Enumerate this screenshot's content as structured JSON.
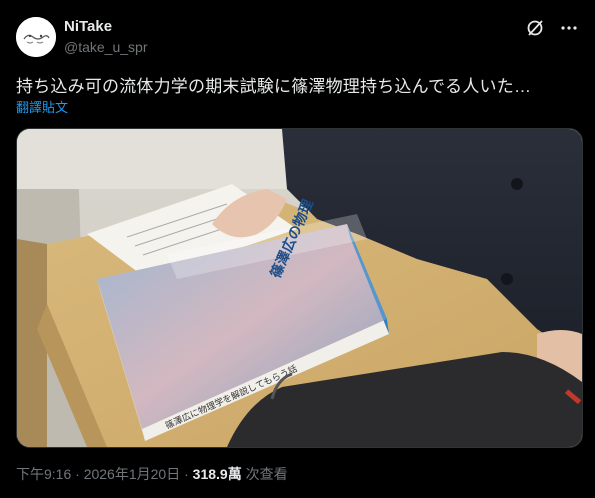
{
  "author": {
    "name": "NiTake",
    "handle": "@take_u_spr"
  },
  "tweet": {
    "text": "持ち込み可の流体力学の期末試験に篠澤物理持ち込んでる人いた…",
    "translate_label": "翻譯貼文"
  },
  "icons": {
    "grok": "grok-icon",
    "more": "more-options-icon"
  },
  "meta": {
    "time": "下午9:16",
    "separator": "·",
    "date": "2026年1月20日",
    "views_count": "318.9萬",
    "views_label": "次查看"
  },
  "photo": {
    "book_title": "篠澤広に物理学を解説してもらう話",
    "book_title_spine_label": "篠澤広の物理"
  },
  "colors": {
    "background": "#000000",
    "text": "#e7e9ea",
    "secondary": "#71767b",
    "link": "#1d9bf0"
  }
}
